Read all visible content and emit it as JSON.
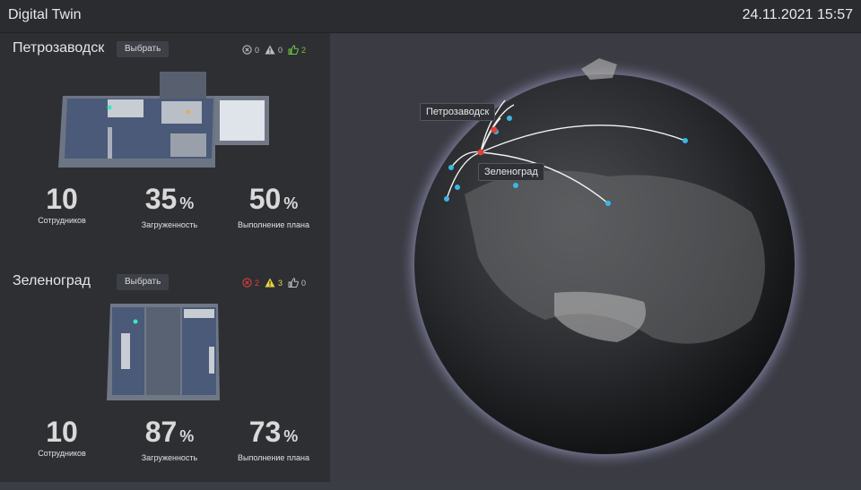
{
  "app": {
    "title": "Digital Twin",
    "datetime": "24.11.2021 15:57"
  },
  "sites": [
    {
      "name": "Петрозаводск",
      "choose_label": "Выбрать",
      "errors": "0",
      "warnings": "0",
      "likes": "2",
      "employees": "10",
      "employees_label": "Сотрудников",
      "load": "35",
      "load_label": "Загруженность",
      "plan": "50",
      "plan_label": "Выполнение плана",
      "pct": "%"
    },
    {
      "name": "Зеленоград",
      "choose_label": "Выбрать",
      "errors": "2",
      "warnings": "3",
      "likes": "0",
      "employees": "10",
      "employees_label": "Сотрудников",
      "load": "87",
      "load_label": "Загруженность",
      "plan": "73",
      "plan_label": "Выполнение плана",
      "pct": "%"
    }
  ],
  "globe": {
    "label_1": "Петрозаводск",
    "label_2": "Зеленоград"
  },
  "colors": {
    "error": "#e0413a",
    "warning": "#e8d640",
    "like": "#6cc644",
    "neutral": "#bfbfbf",
    "point": "#39b8e6",
    "active_point": "#e0413a"
  }
}
